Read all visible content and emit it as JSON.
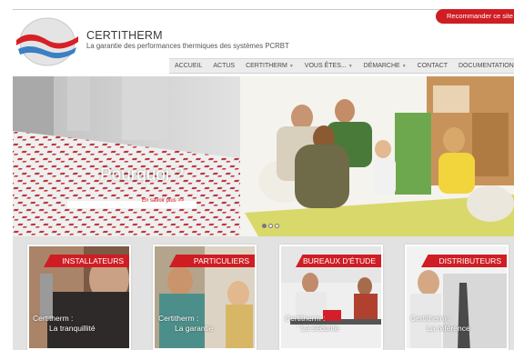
{
  "header": {
    "recommend_label": "Recommander ce site",
    "brand_name": "CERTITHERM",
    "tagline": "La garantie des performances thermiques des systèmes PCRBT"
  },
  "nav": {
    "items": [
      {
        "label": "ACCUEIL",
        "has_dropdown": false
      },
      {
        "label": "ACTUS",
        "has_dropdown": false
      },
      {
        "label": "CERTITHERM",
        "has_dropdown": true
      },
      {
        "label": "VOUS ÊTES...",
        "has_dropdown": true
      },
      {
        "label": "DÉMARCHE",
        "has_dropdown": true
      },
      {
        "label": "CONTACT",
        "has_dropdown": false
      },
      {
        "label": "DOCUMENTATION",
        "has_dropdown": false
      }
    ]
  },
  "hero": {
    "title": "Pourquoi ?",
    "link_label": "En savoir plus >>",
    "slides_total": 3,
    "active_slide": 1
  },
  "cards": [
    {
      "ribbon": "INSTALLATEURS",
      "brand": "Certitherm :",
      "text": "La tranquillité"
    },
    {
      "ribbon": "PARTICULIERS",
      "brand": "Certitherm :",
      "text": "La garantie"
    },
    {
      "ribbon": "BUREAUX D'ÉTUDE",
      "brand": "Certitherm :",
      "text": "La sécurité"
    },
    {
      "ribbon": "DISTRIBUTEURS",
      "brand": "Certitherm :",
      "text": "La référence"
    }
  ],
  "colors": {
    "accent_red": "#cf1d23",
    "logo_blue": "#3b7fc4",
    "nav_bg": "#ececec"
  },
  "icons": {
    "logo": "certitherm-logo-icon",
    "dropdown": "chevron-down-icon"
  }
}
